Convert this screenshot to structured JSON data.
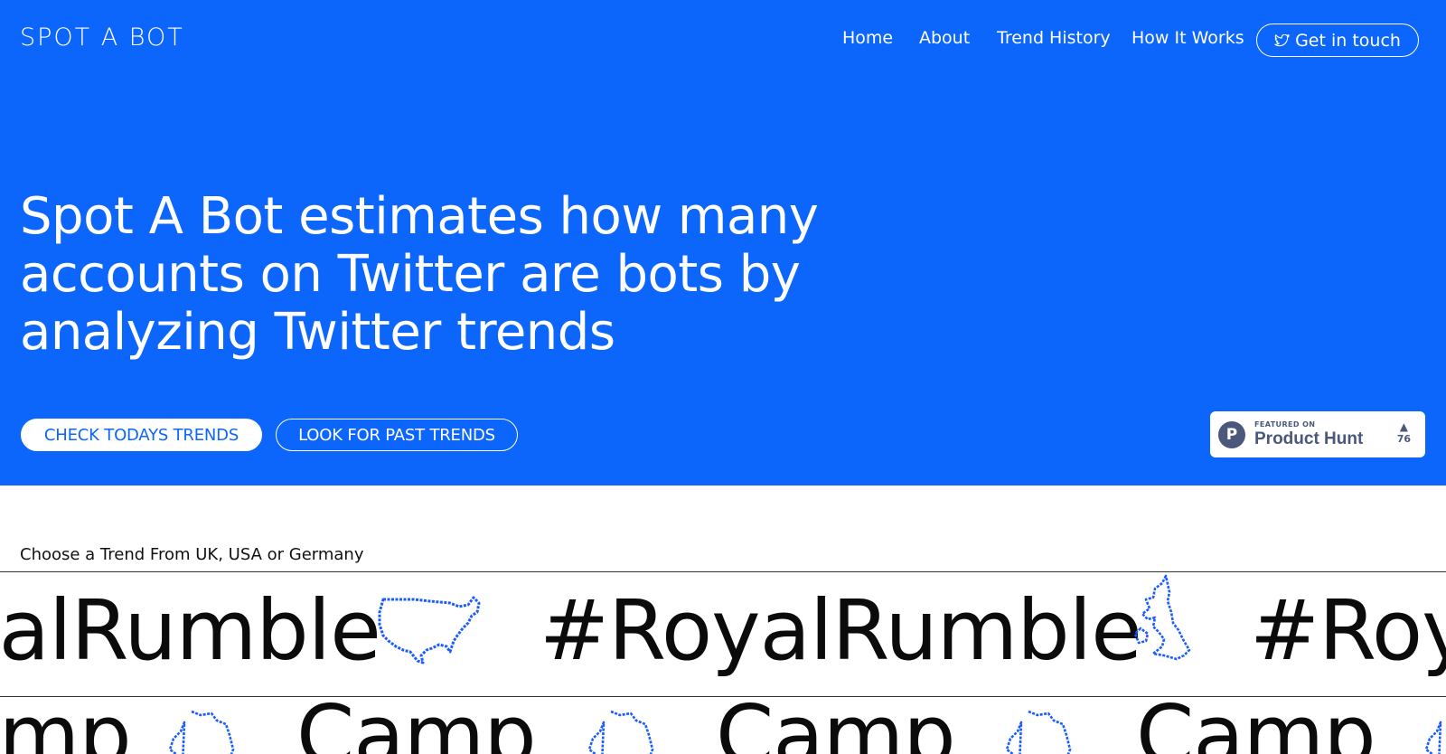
{
  "colors": {
    "accent": "#0d66fb",
    "white": "#ffffff",
    "map_blue": "#1a5cff",
    "producthunt_gray": "#4b587c"
  },
  "header": {
    "logo": "SPOT A BOT",
    "nav": [
      {
        "label": "Home"
      },
      {
        "label": "About"
      },
      {
        "label": "Trend History"
      },
      {
        "label": "How It Works"
      }
    ],
    "contact_button": {
      "label": "Get in touch",
      "icon": "twitter-bird-icon"
    }
  },
  "hero": {
    "headline": "Spot A Bot estimates how many accounts on Twitter are bots by analyzing Twitter trends",
    "primary_cta": "CHECK TODAYS TRENDS",
    "secondary_cta": "LOOK FOR PAST TRENDS"
  },
  "product_hunt": {
    "featured_label": "FEATURED ON",
    "name": "Product Hunt",
    "logo_letter": "P",
    "upvote_icon": "triangle-up-icon",
    "votes": "76"
  },
  "trends": {
    "title": "Choose a Trend From UK, USA or Germany",
    "row1": {
      "items": [
        "#RoyalRumble",
        "#RoyalRumble",
        "#RoyalRumble"
      ],
      "icons": [
        "usa-map-icon",
        "uk-map-icon"
      ]
    },
    "row2": {
      "items": [
        "Camp",
        "Camp",
        "Camp",
        "Camp"
      ],
      "icons": [
        "germany-map-icon",
        "germany-map-icon",
        "germany-map-icon",
        "germany-map-icon"
      ]
    }
  }
}
